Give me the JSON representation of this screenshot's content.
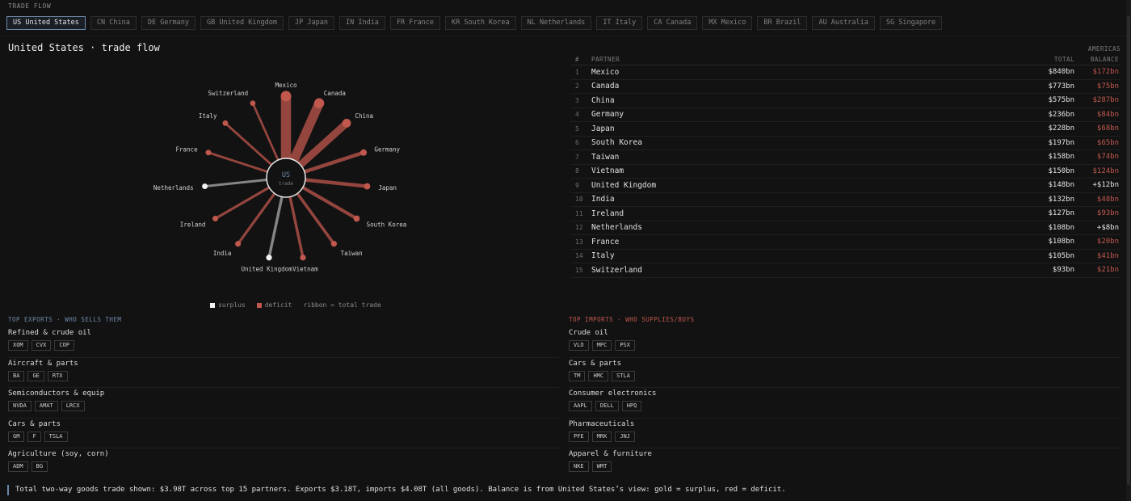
{
  "header": {
    "label": "TRADE FLOW"
  },
  "tabs": [
    {
      "label": "US United States",
      "active": true
    },
    {
      "label": "CN China"
    },
    {
      "label": "DE Germany"
    },
    {
      "label": "GB United Kingdom"
    },
    {
      "label": "JP Japan"
    },
    {
      "label": "IN India"
    },
    {
      "label": "FR France"
    },
    {
      "label": "KR South Korea"
    },
    {
      "label": "NL Netherlands"
    },
    {
      "label": "IT Italy"
    },
    {
      "label": "CA Canada"
    },
    {
      "label": "MX Mexico"
    },
    {
      "label": "BR Brazil"
    },
    {
      "label": "AU Australia"
    },
    {
      "label": "SG Singapore"
    }
  ],
  "title": "United States · trade flow",
  "colors": {
    "surplus": "#f2f2f2",
    "deficit": "#c0584e",
    "accent": "#6d88a8",
    "exports_head": "#6d88a8",
    "imports_head": "#c0584e",
    "neutral": "#e6e6e6"
  },
  "radial": {
    "center_code": "US",
    "center_sub": "trade",
    "partners": [
      {
        "name": "Mexico",
        "total": 840,
        "balance": -172
      },
      {
        "name": "Canada",
        "total": 773,
        "balance": -75
      },
      {
        "name": "China",
        "total": 575,
        "balance": -287
      },
      {
        "name": "Germany",
        "total": 236,
        "balance": -84
      },
      {
        "name": "Japan",
        "total": 228,
        "balance": -68
      },
      {
        "name": "South Korea",
        "total": 197,
        "balance": -65
      },
      {
        "name": "Taiwan",
        "total": 158,
        "balance": -74
      },
      {
        "name": "Vietnam",
        "total": 150,
        "balance": -124
      },
      {
        "name": "United Kingdom",
        "total": 148,
        "balance": 12
      },
      {
        "name": "India",
        "total": 132,
        "balance": -48
      },
      {
        "name": "Ireland",
        "total": 127,
        "balance": -93
      },
      {
        "name": "Netherlands",
        "total": 108,
        "balance": 8
      },
      {
        "name": "France",
        "total": 108,
        "balance": -20
      },
      {
        "name": "Italy",
        "total": 105,
        "balance": -41
      },
      {
        "name": "Switzerland",
        "total": 93,
        "balance": -21
      }
    ]
  },
  "legend": {
    "surplus": "surplus",
    "deficit": "deficit",
    "note": "ribbon = total trade"
  },
  "table": {
    "region": "AMERICAS",
    "headers": {
      "num": "#",
      "partner": "PARTNER",
      "total": "TOTAL",
      "balance": "BALANCE"
    },
    "rows": [
      {
        "num": "1",
        "name": "Mexico",
        "total": "$840bn",
        "balance": "$172bn",
        "deficit": true
      },
      {
        "num": "2",
        "name": "Canada",
        "total": "$773bn",
        "balance": "$75bn",
        "deficit": true
      },
      {
        "num": "3",
        "name": "China",
        "total": "$575bn",
        "balance": "$287bn",
        "deficit": true
      },
      {
        "num": "4",
        "name": "Germany",
        "total": "$236bn",
        "balance": "$84bn",
        "deficit": true
      },
      {
        "num": "5",
        "name": "Japan",
        "total": "$228bn",
        "balance": "$68bn",
        "deficit": true
      },
      {
        "num": "6",
        "name": "South Korea",
        "total": "$197bn",
        "balance": "$65bn",
        "deficit": true
      },
      {
        "num": "7",
        "name": "Taiwan",
        "total": "$158bn",
        "balance": "$74bn",
        "deficit": true
      },
      {
        "num": "8",
        "name": "Vietnam",
        "total": "$150bn",
        "balance": "$124bn",
        "deficit": true
      },
      {
        "num": "9",
        "name": "United Kingdom",
        "total": "$148bn",
        "balance": "+$12bn",
        "deficit": false
      },
      {
        "num": "10",
        "name": "India",
        "total": "$132bn",
        "balance": "$48bn",
        "deficit": true
      },
      {
        "num": "11",
        "name": "Ireland",
        "total": "$127bn",
        "balance": "$93bn",
        "deficit": true
      },
      {
        "num": "12",
        "name": "Netherlands",
        "total": "$108bn",
        "balance": "+$8bn",
        "deficit": false
      },
      {
        "num": "13",
        "name": "France",
        "total": "$108bn",
        "balance": "$20bn",
        "deficit": true
      },
      {
        "num": "14",
        "name": "Italy",
        "total": "$105bn",
        "balance": "$41bn",
        "deficit": true
      },
      {
        "num": "15",
        "name": "Switzerland",
        "total": "$93bn",
        "balance": "$21bn",
        "deficit": true
      }
    ]
  },
  "exports": {
    "heading": "TOP EXPORTS · WHO SELLS THEM",
    "groups": [
      {
        "title": "Refined & crude oil",
        "tickers": [
          "XOM",
          "CVX",
          "COP"
        ]
      },
      {
        "title": "Aircraft & parts",
        "tickers": [
          "BA",
          "GE",
          "RTX"
        ]
      },
      {
        "title": "Semiconductors & equip",
        "tickers": [
          "NVDA",
          "AMAT",
          "LRCX"
        ]
      },
      {
        "title": "Cars & parts",
        "tickers": [
          "GM",
          "F",
          "TSLA"
        ]
      },
      {
        "title": "Agriculture (soy, corn)",
        "tickers": [
          "ADM",
          "BG"
        ]
      }
    ]
  },
  "imports": {
    "heading": "TOP IMPORTS · WHO SUPPLIES/BUYS",
    "groups": [
      {
        "title": "Crude oil",
        "tickers": [
          "VLO",
          "MPC",
          "PSX"
        ]
      },
      {
        "title": "Cars & parts",
        "tickers": [
          "TM",
          "HMC",
          "STLA"
        ]
      },
      {
        "title": "Consumer electronics",
        "tickers": [
          "AAPL",
          "DELL",
          "HPQ"
        ]
      },
      {
        "title": "Pharmaceuticals",
        "tickers": [
          "PFE",
          "MRK",
          "JNJ"
        ]
      },
      {
        "title": "Apparel & furniture",
        "tickers": [
          "NKE",
          "WMT"
        ]
      }
    ]
  },
  "footer": "Total two-way goods trade shown: $3.98T across top 15 partners. Exports $3.18T, imports $4.08T (all goods). Balance is from United States’s view: gold = surplus, red = deficit."
}
